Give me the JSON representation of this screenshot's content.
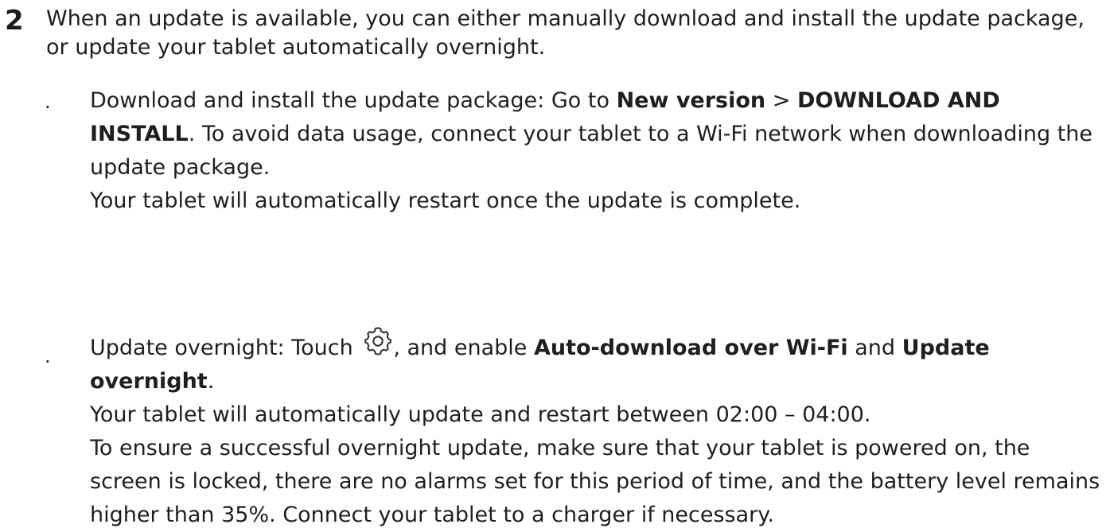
{
  "step": {
    "number": "2",
    "text": "When an update is available, you can either manually download and install the update package, or update your tablet automatically overnight."
  },
  "items": [
    {
      "bullet": "·",
      "intro": "Download and install the update package: Go to ",
      "bold1": "New version",
      "sep": " > ",
      "bold2": "DOWNLOAD AND INSTALL",
      "rest": ". To avoid data usage, connect your tablet to a Wi-Fi network when downloading the update package.",
      "note": "Your tablet will automatically restart once the update is complete."
    },
    {
      "bullet": "·",
      "intro": "Update overnight: Touch ",
      "icon": "gear-icon",
      "mid": ", and enable ",
      "bold1": "Auto-download over Wi-Fi",
      "and": " and ",
      "bold2": "Update overnight",
      "end": ".",
      "note1": "Your tablet will automatically update and restart between 02:00 – 04:00.",
      "note2": "To ensure a successful overnight update, make sure that your tablet is powered on, the screen is locked, there are no alarms set for this period of time, and the battery level remains higher than 35%. Connect your tablet to a charger if necessary."
    }
  ]
}
